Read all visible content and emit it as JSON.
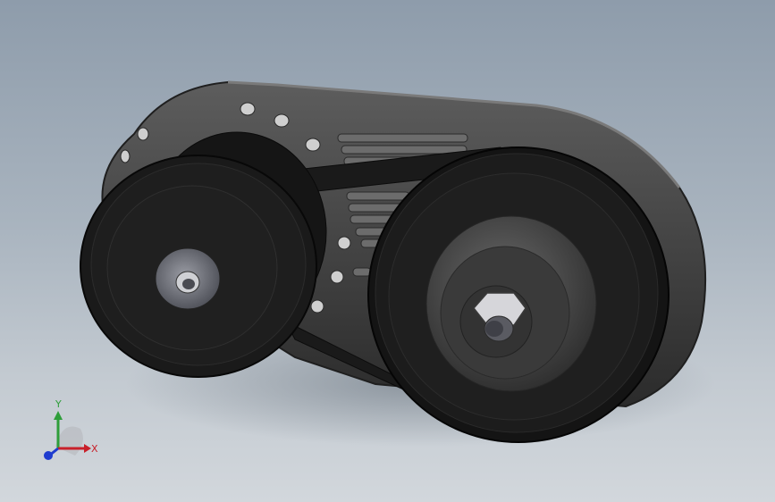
{
  "viewport": {
    "background_top": "#8e9cab",
    "background_bottom": "#d2d7dc"
  },
  "model": {
    "parts": [
      "driver-pulley",
      "driven-pulley",
      "v-belt",
      "housing-cover",
      "hex-nut",
      "roller-set"
    ],
    "colors": {
      "pulley": "#1a1a1a",
      "housing": "#4a4a4a",
      "hub": "#6e7078",
      "belt": "#161616"
    }
  },
  "triad": {
    "x_label": "X",
    "y_label": "Y",
    "x_color": "#c8202a",
    "y_color": "#2e9e3a",
    "z_color": "#1f3ccf"
  }
}
